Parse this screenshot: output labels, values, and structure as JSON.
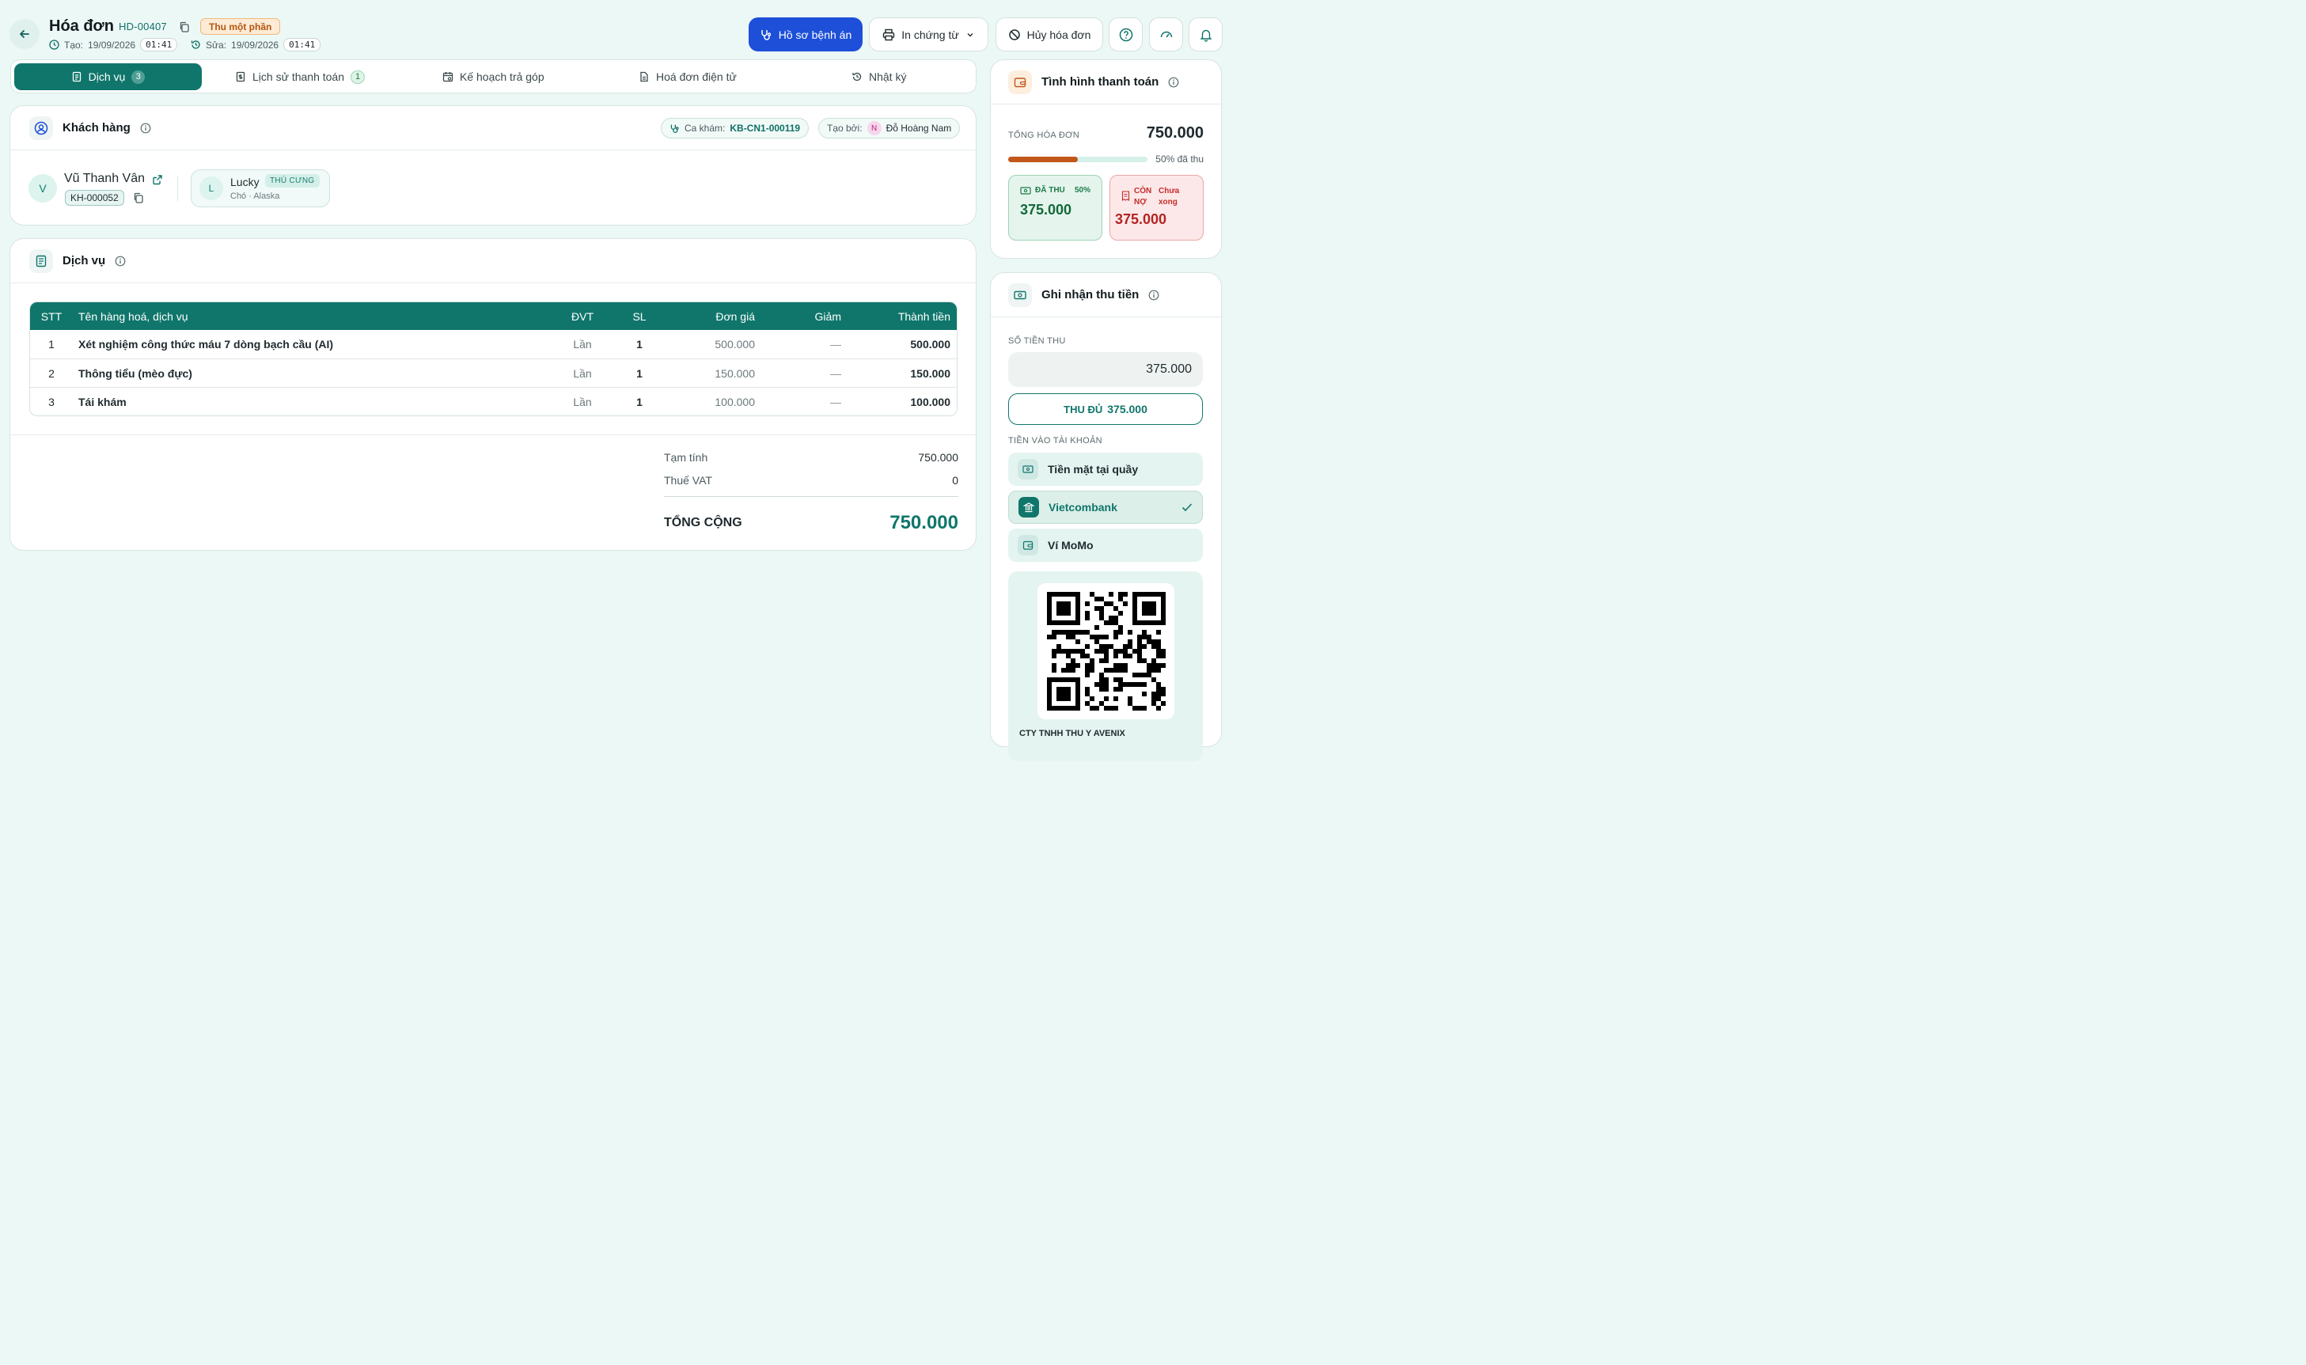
{
  "header": {
    "title": "Hóa đơn",
    "code": "HD-00407",
    "status": "Thu một phần",
    "created_label": "Tạo:",
    "created_date": "19/09/2026",
    "created_time": "01:41",
    "edited_label": "Sửa:",
    "edited_date": "19/09/2026",
    "edited_time": "01:41",
    "btn_medical": "Hồ sơ bệnh án",
    "btn_print": "In chứng từ",
    "btn_cancel": "Hủy hóa đơn"
  },
  "tabs": [
    {
      "label": "Dịch vụ",
      "count": "3"
    },
    {
      "label": "Lịch sử thanh toán",
      "count": "1"
    },
    {
      "label": "Kế hoạch trả góp"
    },
    {
      "label": "Hoá đơn điện tử"
    },
    {
      "label": "Nhật ký"
    }
  ],
  "customer": {
    "section_title": "Khách hàng",
    "visit_label": "Ca khám:",
    "visit_code": "KB-CN1-000119",
    "created_by_label": "Tạo bởi:",
    "created_by_initial": "N",
    "created_by_name": "Đỗ Hoàng Nam",
    "initial": "V",
    "name": "Vũ Thanh Vân",
    "code": "KH-000052",
    "pet": {
      "initial": "L",
      "name": "Lucky",
      "tag": "THÚ CƯNG",
      "desc": "Chó · Alaska"
    }
  },
  "services": {
    "section_title": "Dịch vụ",
    "columns": [
      "STT",
      "Tên hàng hoá, dịch vụ",
      "ĐVT",
      "SL",
      "Đơn giá",
      "Giảm",
      "Thành tiền"
    ],
    "rows": [
      {
        "stt": "1",
        "name": "Xét nghiệm công thức máu 7 dòng bạch cầu (AI)",
        "unit": "Lần",
        "qty": "1",
        "price": "500.000",
        "discount": "—",
        "total": "500.000"
      },
      {
        "stt": "2",
        "name": "Thông tiểu (mèo đực)",
        "unit": "Lần",
        "qty": "1",
        "price": "150.000",
        "discount": "—",
        "total": "150.000"
      },
      {
        "stt": "3",
        "name": "Tái khám",
        "unit": "Lần",
        "qty": "1",
        "price": "100.000",
        "discount": "—",
        "total": "100.000"
      }
    ],
    "subtotal_label": "Tạm tính",
    "subtotal": "750.000",
    "vat_label": "Thuế VAT",
    "vat": "0",
    "total_label": "TỔNG CỘNG",
    "total": "750.000"
  },
  "payment_status": {
    "title": "Tình hình thanh toán",
    "total_label": "TỔNG HÓA ĐƠN",
    "total": "750.000",
    "progress_percent": 50,
    "progress_text": "50% đã thu",
    "paid_label": "ĐÃ THU",
    "paid_pct": "50%",
    "paid_amount": "375.000",
    "owe_label_1": "CÒN",
    "owe_label_2": "NỢ",
    "owe_note_1": "Chưa",
    "owe_note_2": "xong",
    "owe_amount": "375.000"
  },
  "collect": {
    "title": "Ghi nhận thu tiền",
    "amount_label": "SỐ TIỀN THU",
    "amount_value": "375.000",
    "full_btn_label": "THU ĐỦ",
    "full_btn_amount": "375.000",
    "account_label": "TIỀN VÀO TÀI KHOẢN",
    "accounts": [
      "Tiền mặt tại quầy",
      "Vietcombank",
      "Ví MoMo"
    ],
    "qr_caption": "CTY TNHH THU Y AVENIX"
  },
  "colors": {
    "primary": "#10766b",
    "accent_blue": "#1d4fd8",
    "warning": "#b5560f",
    "danger": "#c52b2b"
  }
}
